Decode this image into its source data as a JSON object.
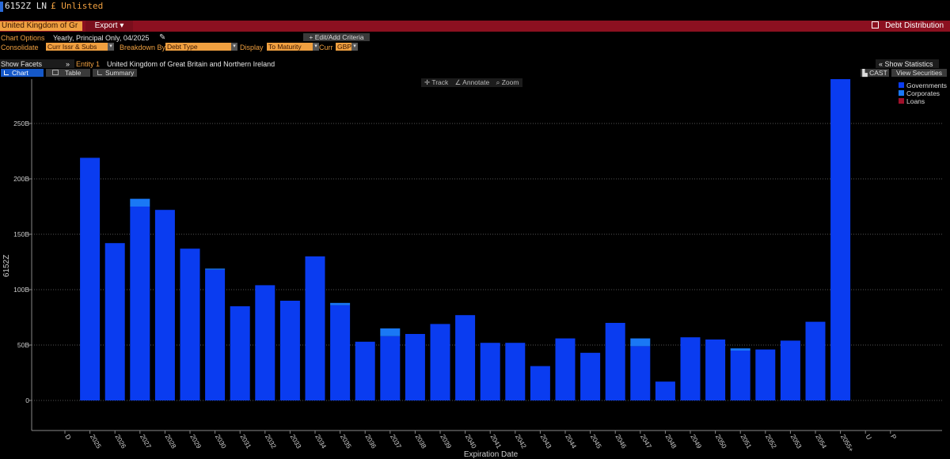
{
  "header": {
    "ticker": "6152Z LN",
    "listing": "£ Unlisted"
  },
  "toolbar": {
    "entity_field": "United Kingdom of Gr",
    "export_label": "Export ▾",
    "right_action": "Debt Distribution"
  },
  "options": {
    "chart_options_label": "Chart Options",
    "chart_options_value": "Yearly, Principal Only, 04/2025",
    "edit_criteria_label": "+ Edit/Add Criteria",
    "consolidate_label": "Consolidate",
    "consolidate_value": "Curr Issr & Subs",
    "breakdown_label": "Breakdown By",
    "breakdown_value": "Debt Type",
    "display_label": "Display",
    "display_value": "To Maturity",
    "curr_label": "Curr",
    "curr_value": "GBP"
  },
  "facets": {
    "show_facets": "Show Facets",
    "arrow": "»",
    "entity_label": "Entity 1",
    "entity_value": "United Kingdom of Great Britain and Northern Ireland",
    "show_statistics": "« Show Statistics"
  },
  "tabs": [
    {
      "label": "Chart",
      "active": true
    },
    {
      "label": "Table",
      "active": false
    },
    {
      "label": "Summary",
      "active": false
    }
  ],
  "buttons": {
    "cast": "CAST",
    "view_securities": "View Securities"
  },
  "chart_tools": {
    "track": "Track",
    "annotate": "Annotate",
    "zoom": "Zoom"
  },
  "colors": {
    "governments": "#0a3cf0",
    "corporates": "#1a78f5",
    "loans": "#a0102a",
    "accent": "#f0a040",
    "bar": "#8c1020"
  },
  "chart_data": {
    "type": "bar",
    "stacked": true,
    "xlabel": "Expiration Date",
    "ylabel": "6152Z",
    "ylim": [
      0,
      290
    ],
    "yticks": [
      0,
      50,
      100,
      150,
      200,
      250
    ],
    "ytick_labels": [
      "0",
      "50B",
      "100B",
      "150B",
      "200B",
      "250B"
    ],
    "grid": true,
    "legend_position": "top-right",
    "categories": [
      "D",
      "2025",
      "2026",
      "2027",
      "2028",
      "2029",
      "2030",
      "2031",
      "2032",
      "2033",
      "2034",
      "2035",
      "2036",
      "2037",
      "2038",
      "2039",
      "2040",
      "2041",
      "2042",
      "2043",
      "2044",
      "2045",
      "2046",
      "2047",
      "2048",
      "2049",
      "2050",
      "2051",
      "2052",
      "2053",
      "2054",
      "2055+",
      "U",
      "P"
    ],
    "series": [
      {
        "name": "Governments",
        "color": "#0a3cf0",
        "values": [
          0,
          219,
          142,
          175,
          172,
          137,
          118,
          85,
          104,
          90,
          130,
          86,
          53,
          58,
          60,
          69,
          77,
          52,
          52,
          31,
          56,
          43,
          70,
          49,
          17,
          57,
          55,
          45,
          46,
          54,
          71,
          290,
          0,
          0
        ]
      },
      {
        "name": "Corporates",
        "color": "#1a78f5",
        "values": [
          0,
          0,
          0,
          7,
          0,
          0,
          1,
          0,
          0,
          0,
          0,
          2,
          0,
          7,
          0,
          0,
          0,
          0,
          0,
          0,
          0,
          0,
          0,
          7,
          0,
          0,
          0,
          2,
          0,
          0,
          0,
          0,
          0,
          0
        ]
      },
      {
        "name": "Loans",
        "color": "#a0102a",
        "values": [
          0,
          0,
          0,
          0,
          0,
          0,
          0,
          0,
          0,
          0,
          0,
          0,
          0,
          0,
          0,
          0,
          0,
          0,
          0,
          0,
          0,
          0,
          0,
          0,
          0,
          0,
          0,
          0,
          0,
          0,
          0,
          0,
          0,
          0
        ]
      }
    ]
  }
}
